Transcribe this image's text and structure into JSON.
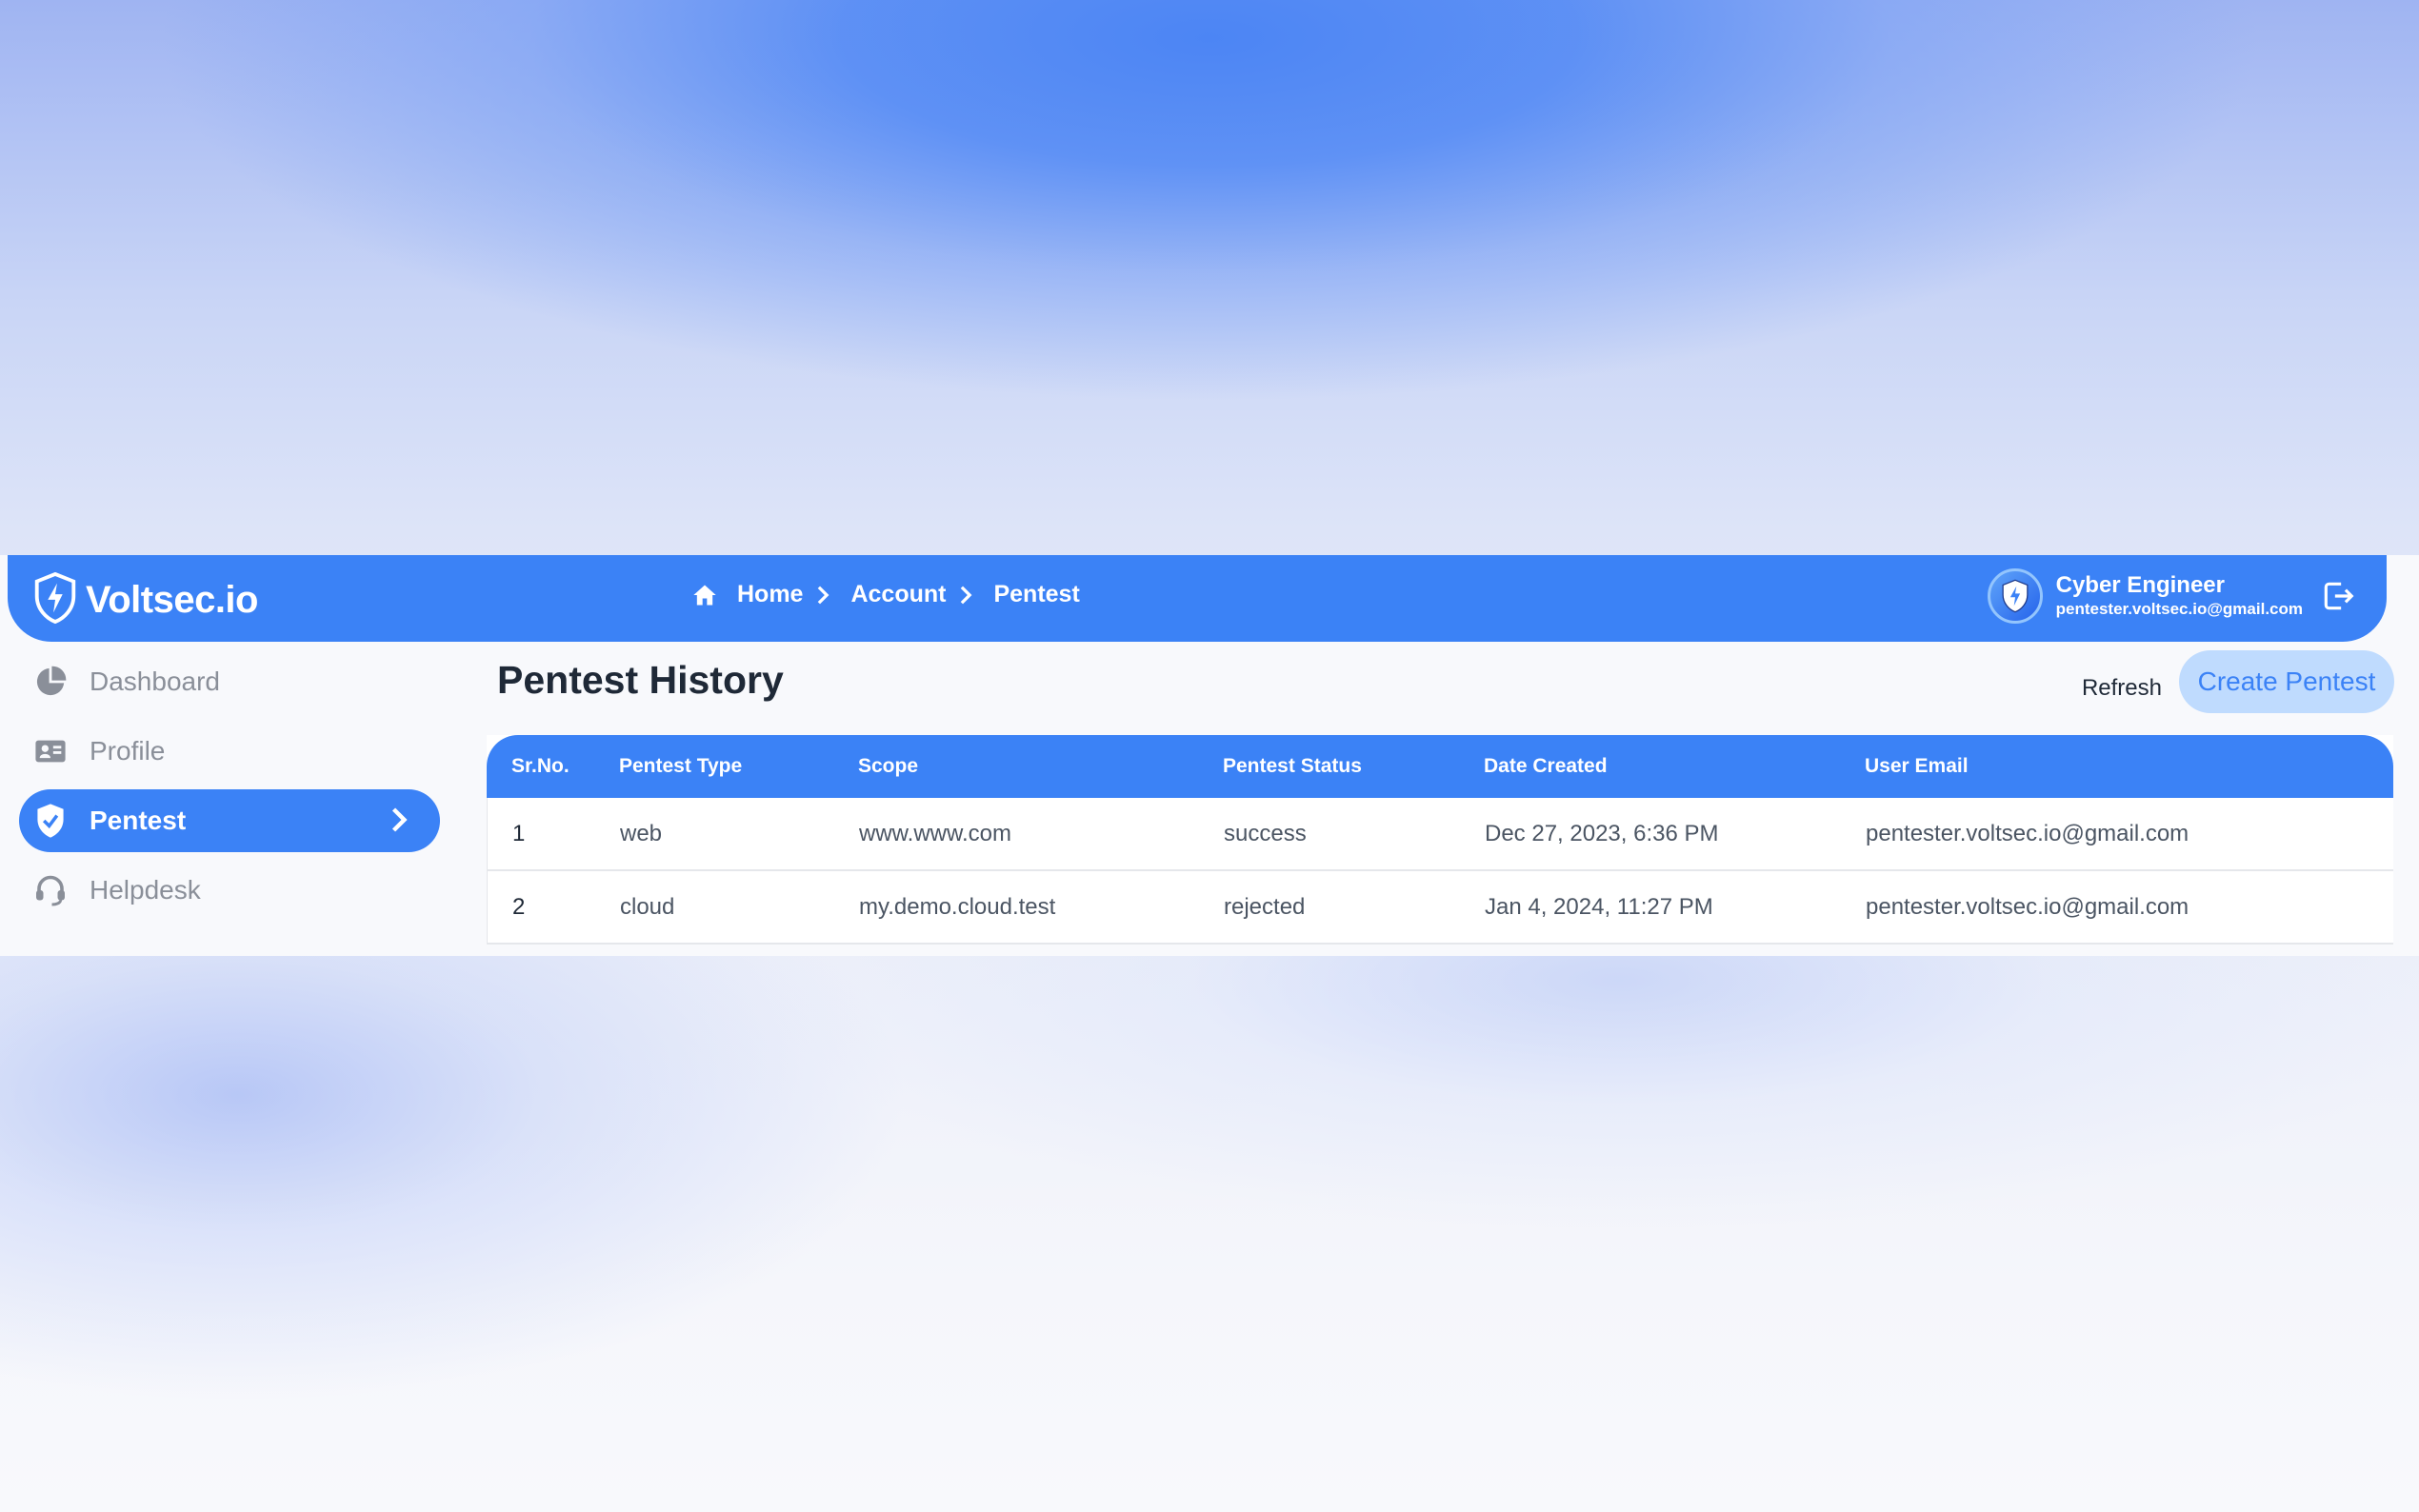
{
  "app": {
    "logo_text": "Voltsec.io"
  },
  "breadcrumb": {
    "items": [
      "Home",
      "Account",
      "Pentest"
    ]
  },
  "user": {
    "name": "Cyber Engineer",
    "email": "pentester.voltsec.io@gmail.com"
  },
  "sidebar": {
    "items": [
      {
        "label": "Dashboard",
        "icon": "pie-chart-icon",
        "active": false
      },
      {
        "label": "Profile",
        "icon": "id-card-icon",
        "active": false
      },
      {
        "label": "Pentest",
        "icon": "shield-check-icon",
        "active": true
      },
      {
        "label": "Helpdesk",
        "icon": "headset-icon",
        "active": false
      }
    ]
  },
  "main": {
    "title": "Pentest History",
    "refresh_label": "Refresh",
    "create_label": "Create Pentest"
  },
  "table": {
    "headers": [
      "Sr.No.",
      "Pentest Type",
      "Scope",
      "Pentest Status",
      "Date Created",
      "User Email"
    ],
    "rows": [
      [
        "1",
        "web",
        "www.www.com",
        "success",
        "Dec 27, 2023, 6:36 PM",
        "pentester.voltsec.io@gmail.com"
      ],
      [
        "2",
        "cloud",
        "my.demo.cloud.test",
        "rejected",
        "Jan 4, 2024, 11:27 PM",
        "pentester.voltsec.io@gmail.com"
      ]
    ]
  },
  "colors": {
    "primary": "#3b82f6",
    "button_bg": "#bfdbfe",
    "sidebar_text": "#8a8f99"
  }
}
